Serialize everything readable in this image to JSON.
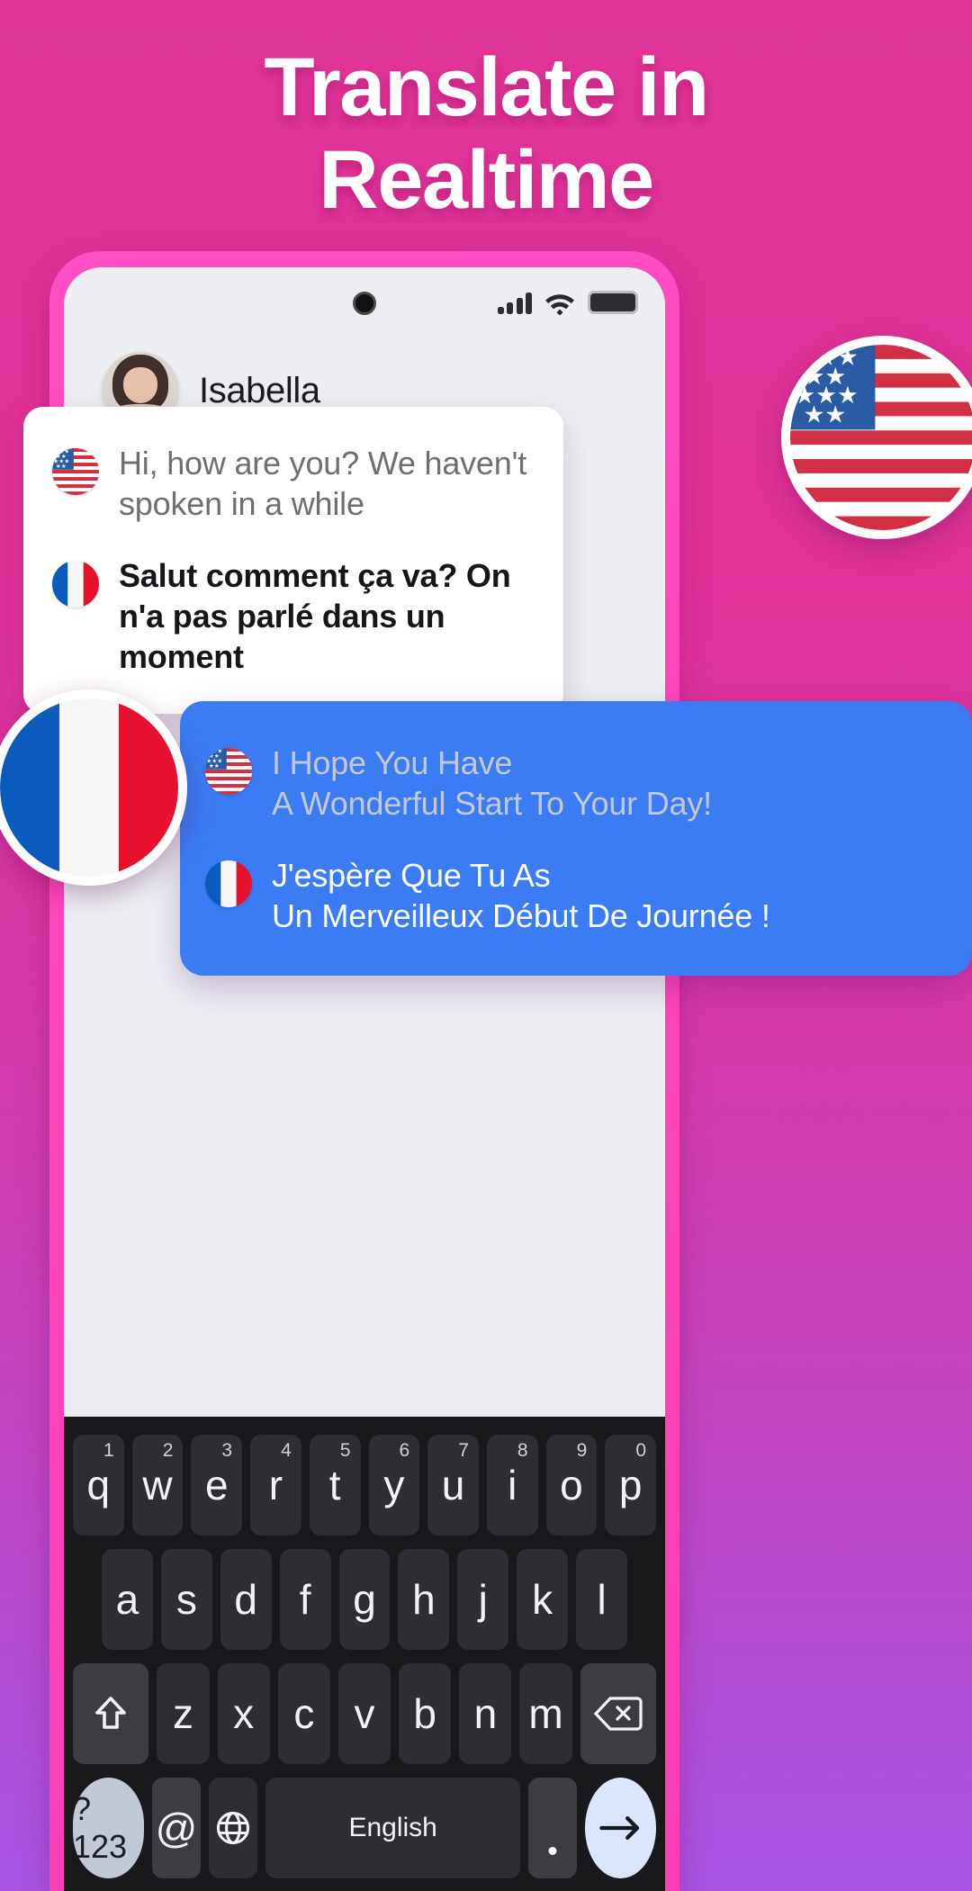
{
  "headline": {
    "line1": "Translate in",
    "line2": "Realtime"
  },
  "colors": {
    "background_top": "#e03597",
    "background_bottom": "#a855e4",
    "phone_frame": "#ff4fc3",
    "screen": "#eceef2",
    "bubble_incoming": "#ffffff",
    "bubble_outgoing": "#3b7cf5",
    "keyboard": "#19191b",
    "key": "#2d2e31",
    "key_modifier": "#3c3d40",
    "enter_key": "#dbe6fb",
    "num_key": "#c2c9d6"
  },
  "status_bar": {
    "camera": "camera-dot",
    "signal": "signal-icon",
    "wifi": "wifi-icon",
    "battery": "battery-icon"
  },
  "contact": {
    "name": "Isabella",
    "avatar": "avatar-isabella"
  },
  "messages": [
    {
      "side": "incoming",
      "source_flag": "us-flag",
      "source_text": "Hi, how are you? We haven't spoken in a while",
      "target_flag": "fr-flag",
      "target_text": "Salut comment ça va? On n'a pas parlé dans un moment"
    },
    {
      "side": "outgoing",
      "source_flag": "us-flag",
      "source_line1": "I Hope You Have",
      "source_line2": "A Wonderful Start To Your Day!",
      "target_flag": "fr-flag",
      "target_line1": "J'espère Que Tu As",
      "target_line2": "Un Merveilleux Début De Journée !"
    }
  ],
  "badges": {
    "us": "us-flag-badge",
    "fr": "fr-flag-badge"
  },
  "keyboard": {
    "row1": [
      {
        "letter": "q",
        "num": "1"
      },
      {
        "letter": "w",
        "num": "2"
      },
      {
        "letter": "e",
        "num": "3"
      },
      {
        "letter": "r",
        "num": "4"
      },
      {
        "letter": "t",
        "num": "5"
      },
      {
        "letter": "y",
        "num": "6"
      },
      {
        "letter": "u",
        "num": "7"
      },
      {
        "letter": "i",
        "num": "8"
      },
      {
        "letter": "o",
        "num": "9"
      },
      {
        "letter": "p",
        "num": "0"
      }
    ],
    "row2": [
      "a",
      "s",
      "d",
      "f",
      "g",
      "h",
      "j",
      "k",
      "l"
    ],
    "row3": [
      "z",
      "x",
      "c",
      "v",
      "b",
      "n",
      "m"
    ],
    "shift_label": "shift-icon",
    "backspace_label": "backspace-icon",
    "symbols_label": "?123",
    "at_label": "@",
    "globe_label": "globe-icon",
    "space_label": "English",
    "period_label": ".",
    "enter_label": "→"
  }
}
